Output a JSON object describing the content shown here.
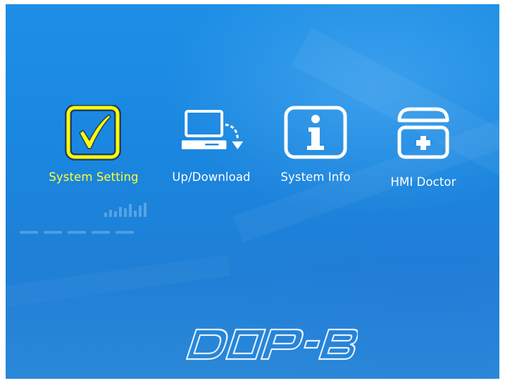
{
  "menu": {
    "items": [
      {
        "label": "System Setting",
        "icon": "checkmark-icon",
        "selected": true
      },
      {
        "label": "Up/Download",
        "icon": "computer-download-icon",
        "selected": false
      },
      {
        "label": "System Info",
        "icon": "info-icon",
        "selected": false
      },
      {
        "label": "HMI Doctor",
        "icon": "medical-kit-icon",
        "selected": false
      }
    ]
  },
  "brand": {
    "logo_text": "DOP-B"
  },
  "colors": {
    "background": "#1e8fe6",
    "selected_label": "#ffff33",
    "label": "#ffffff",
    "selected_icon_border": "#ffff00"
  }
}
